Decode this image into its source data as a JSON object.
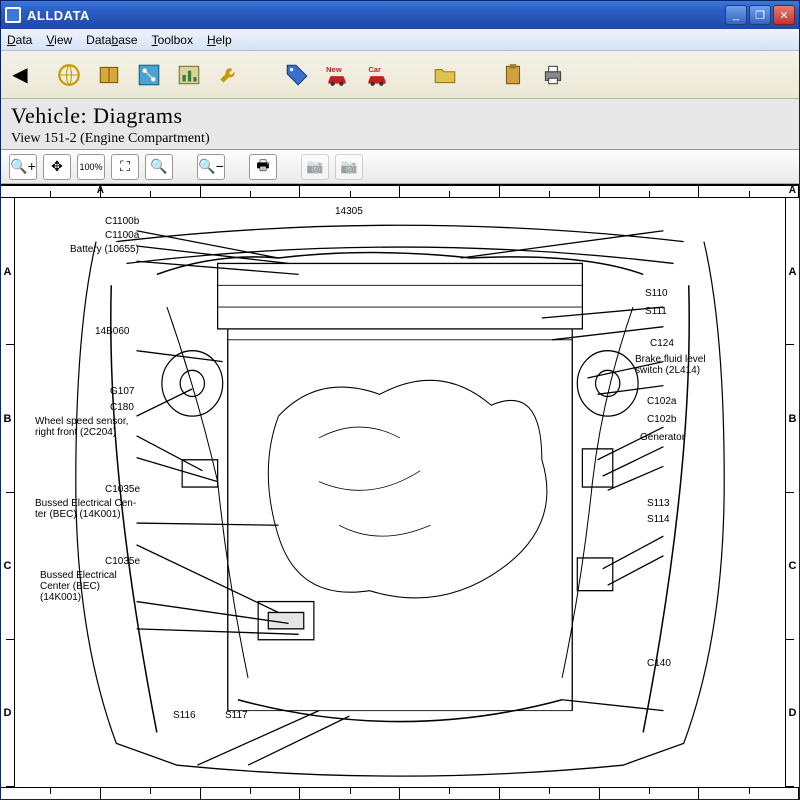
{
  "title": "ALLDATA",
  "menu": {
    "data": "Data",
    "view": "View",
    "database": "Database",
    "toolbox": "Toolbox",
    "help": "Help"
  },
  "header": {
    "vehicle": "Vehicle:  Diagrams",
    "view": "View 151-2 (Engine Compartment)"
  },
  "ruler": {
    "cols": [
      "A",
      "A"
    ],
    "rows": [
      "A",
      "B",
      "C",
      "D"
    ]
  },
  "callouts": {
    "left": [
      {
        "id": "c1100b",
        "text": "C1100b"
      },
      {
        "id": "c1100a",
        "text": "C1100a"
      },
      {
        "id": "battery",
        "text": "Battery (10655)"
      },
      {
        "id": "r14b060",
        "text": "14B060"
      },
      {
        "id": "g107",
        "text": "G107"
      },
      {
        "id": "c180",
        "text": "C180"
      },
      {
        "id": "wheelspeed",
        "text": "Wheel speed sensor,\nright front (2C204)"
      },
      {
        "id": "c1035e",
        "text": "C1035e"
      },
      {
        "id": "bec1",
        "text": "Bussed Electrical Cen-\nter (BEC) (14K001)"
      },
      {
        "id": "c1035e2",
        "text": "C1035e"
      },
      {
        "id": "bec2",
        "text": "Bussed Electrical\nCenter (BEC)\n(14K001)"
      },
      {
        "id": "s116",
        "text": "S116"
      },
      {
        "id": "s117",
        "text": "S117"
      }
    ],
    "right": [
      {
        "id": "r14305",
        "text": "14305"
      },
      {
        "id": "s110",
        "text": "S110"
      },
      {
        "id": "s111",
        "text": "S111"
      },
      {
        "id": "c124",
        "text": "C124"
      },
      {
        "id": "brakefluid",
        "text": "Brake fluid level\nswitch (2L414)"
      },
      {
        "id": "c102a",
        "text": "C102a"
      },
      {
        "id": "c102b",
        "text": "C102b"
      },
      {
        "id": "generator",
        "text": "Generator"
      },
      {
        "id": "s113",
        "text": "S113"
      },
      {
        "id": "s114",
        "text": "S114"
      },
      {
        "id": "c140",
        "text": "C140"
      }
    ]
  }
}
